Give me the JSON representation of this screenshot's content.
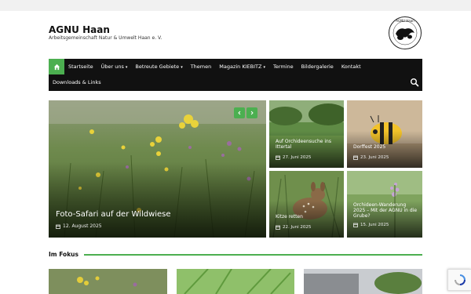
{
  "site": {
    "title": "AGNU Haan",
    "description": "Arbeitsgemeinschaft Natur & Umwelt Haan e. V.",
    "logo_text": "AGNU Haan",
    "logo_subtext": "Arbeitsgemeinschaft Natur + Umweltschutz Haan e.V."
  },
  "nav": {
    "row1": [
      {
        "label": "Startseite",
        "has_submenu": false
      },
      {
        "label": "Über uns",
        "has_submenu": true
      },
      {
        "label": "Betreute Gebiete",
        "has_submenu": true
      },
      {
        "label": "Themen",
        "has_submenu": false
      },
      {
        "label": "Magazin KIEBITZ",
        "has_submenu": true
      },
      {
        "label": "Termine",
        "has_submenu": false
      },
      {
        "label": "Bildergalerie",
        "has_submenu": false
      },
      {
        "label": "Kontakt",
        "has_submenu": false
      }
    ],
    "row2": [
      {
        "label": "Downloads & Links",
        "has_submenu": false
      }
    ],
    "caret": "▾"
  },
  "featured": {
    "hero": {
      "title": "Foto-Safari auf der Wildwiese",
      "date": "12. August 2025"
    },
    "tiles": [
      {
        "title": "Auf Orchideensuche ins Ittertal",
        "date": "27. Juni 2025"
      },
      {
        "title": "Dorffest 2025",
        "date": "23. Juni 2025"
      },
      {
        "title": "Kitze retten",
        "date": "22. Juni 2025"
      },
      {
        "title": "Orchideen-Wanderung 2025 – Mit der AGNU in die Grube?",
        "date": "15. Juni 2025"
      }
    ]
  },
  "section": {
    "heading": "Im Fokus"
  },
  "colors": {
    "accent": "#4caf50",
    "nav_bg": "#111111"
  }
}
